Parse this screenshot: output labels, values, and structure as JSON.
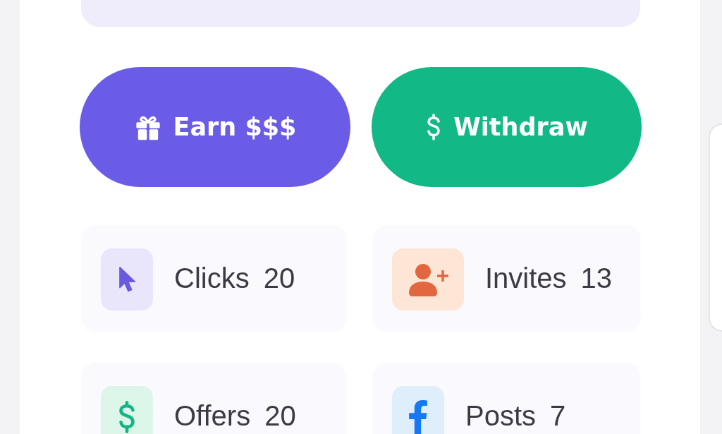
{
  "actions": [
    {
      "kind": "earn",
      "label": "Earn $$$"
    },
    {
      "kind": "withdraw",
      "label": "Withdraw"
    }
  ],
  "stats": [
    {
      "kind": "clicks",
      "label": "Clicks",
      "value": "20"
    },
    {
      "kind": "invites",
      "label": "Invites",
      "value": "13"
    },
    {
      "kind": "offers",
      "label": "Offers",
      "value": "20"
    },
    {
      "kind": "posts",
      "label": "Posts",
      "value": "7"
    }
  ]
}
